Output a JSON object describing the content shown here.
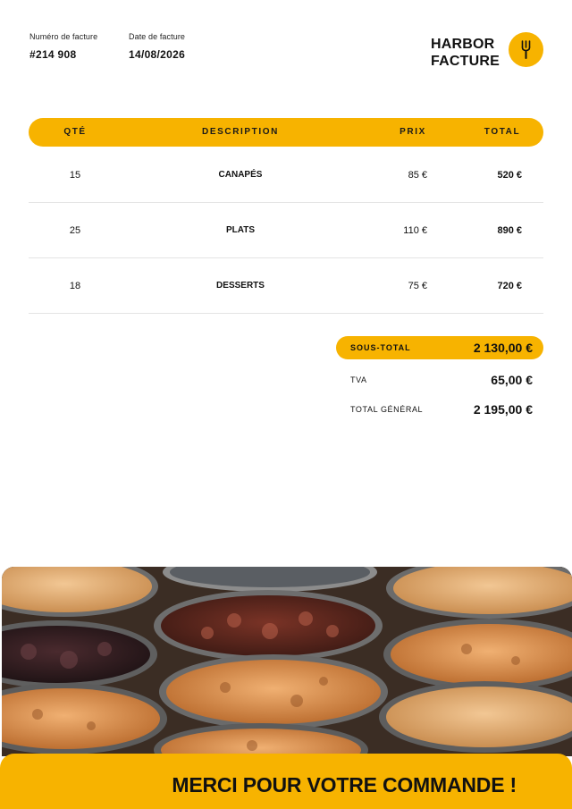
{
  "header": {
    "invoice_number_label": "Numéro de facture",
    "invoice_number": "#214 908",
    "invoice_date_label": "Date de facture",
    "invoice_date": "14/08/2026",
    "brand_line1": "HARBOR",
    "brand_line2": "FACTURE",
    "brand_icon": "fork-icon"
  },
  "table": {
    "columns": [
      "QTÉ",
      "DESCRIPTION",
      "PRIX",
      "TOTAL"
    ],
    "rows": [
      {
        "qty": "15",
        "description": "CANAPÉS",
        "price": "85 €",
        "total": "520 €"
      },
      {
        "qty": "25",
        "description": "PLATS",
        "price": "110 €",
        "total": "890 €"
      },
      {
        "qty": "18",
        "description": "DESSERTS",
        "price": "75 €",
        "total": "720 €"
      }
    ]
  },
  "summary": {
    "subtotal_label": "SOUS-TOTAL",
    "subtotal_value": "2 130,00 €",
    "tax_label": "TVA",
    "tax_value": "65,00 €",
    "grand_total_label": "TOTAL GÉNÉRAL",
    "grand_total_value": "2 195,00 €"
  },
  "footer": {
    "message": "MERCI POUR VOTRE COMMANDE !"
  },
  "colors": {
    "accent": "#f7b300",
    "text": "#111111"
  }
}
